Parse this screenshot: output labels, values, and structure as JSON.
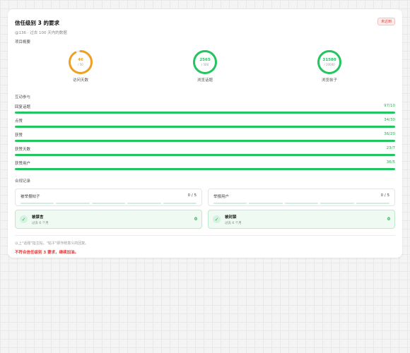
{
  "header": {
    "title": "信任级别 3 的要求",
    "subtitle": "@136 · 过去 100 天内的数据",
    "status_badge": "未达到"
  },
  "overview": {
    "label": "项目概要",
    "rings": [
      {
        "value": "46",
        "max": "/ 50",
        "label": "访问天数",
        "fraction": 0.92,
        "color": "#f0a020"
      },
      {
        "value": "2565",
        "max": "/ 500",
        "label": "浏览话题",
        "fraction": 1.0,
        "color": "#22c55e"
      },
      {
        "value": "31580",
        "max": "/ 20000",
        "label": "浏览帖子",
        "fraction": 1.0,
        "color": "#22c55e"
      }
    ]
  },
  "engagement": {
    "label": "互动参与",
    "bars": [
      {
        "label": "回复话题",
        "value": "97/10",
        "fraction": 1.0
      },
      {
        "label": "点赞",
        "value": "34/30",
        "fraction": 1.0
      },
      {
        "label": "获赞",
        "value": "36/20",
        "fraction": 1.0
      },
      {
        "label": "获赞天数",
        "value": "23/7",
        "fraction": 1.0
      },
      {
        "label": "获赞用户",
        "value": "36/5",
        "fraction": 1.0
      }
    ]
  },
  "compliance": {
    "label": "合规记录",
    "reports": [
      {
        "label": "被举报帖子",
        "value": "0 / 5"
      },
      {
        "label": "举报用户",
        "value": "0 / 5"
      }
    ],
    "statuses": [
      {
        "title": "被禁言",
        "sub": "过去 6 个月",
        "count": "0"
      },
      {
        "title": "被封禁",
        "sub": "过去 6 个月",
        "count": "0"
      }
    ]
  },
  "footer": {
    "note": "以上\"话题\"指主帖，\"帖子\"即作统意义的回复。",
    "result": "不符合信任级别 3 要求，继续加油。"
  }
}
